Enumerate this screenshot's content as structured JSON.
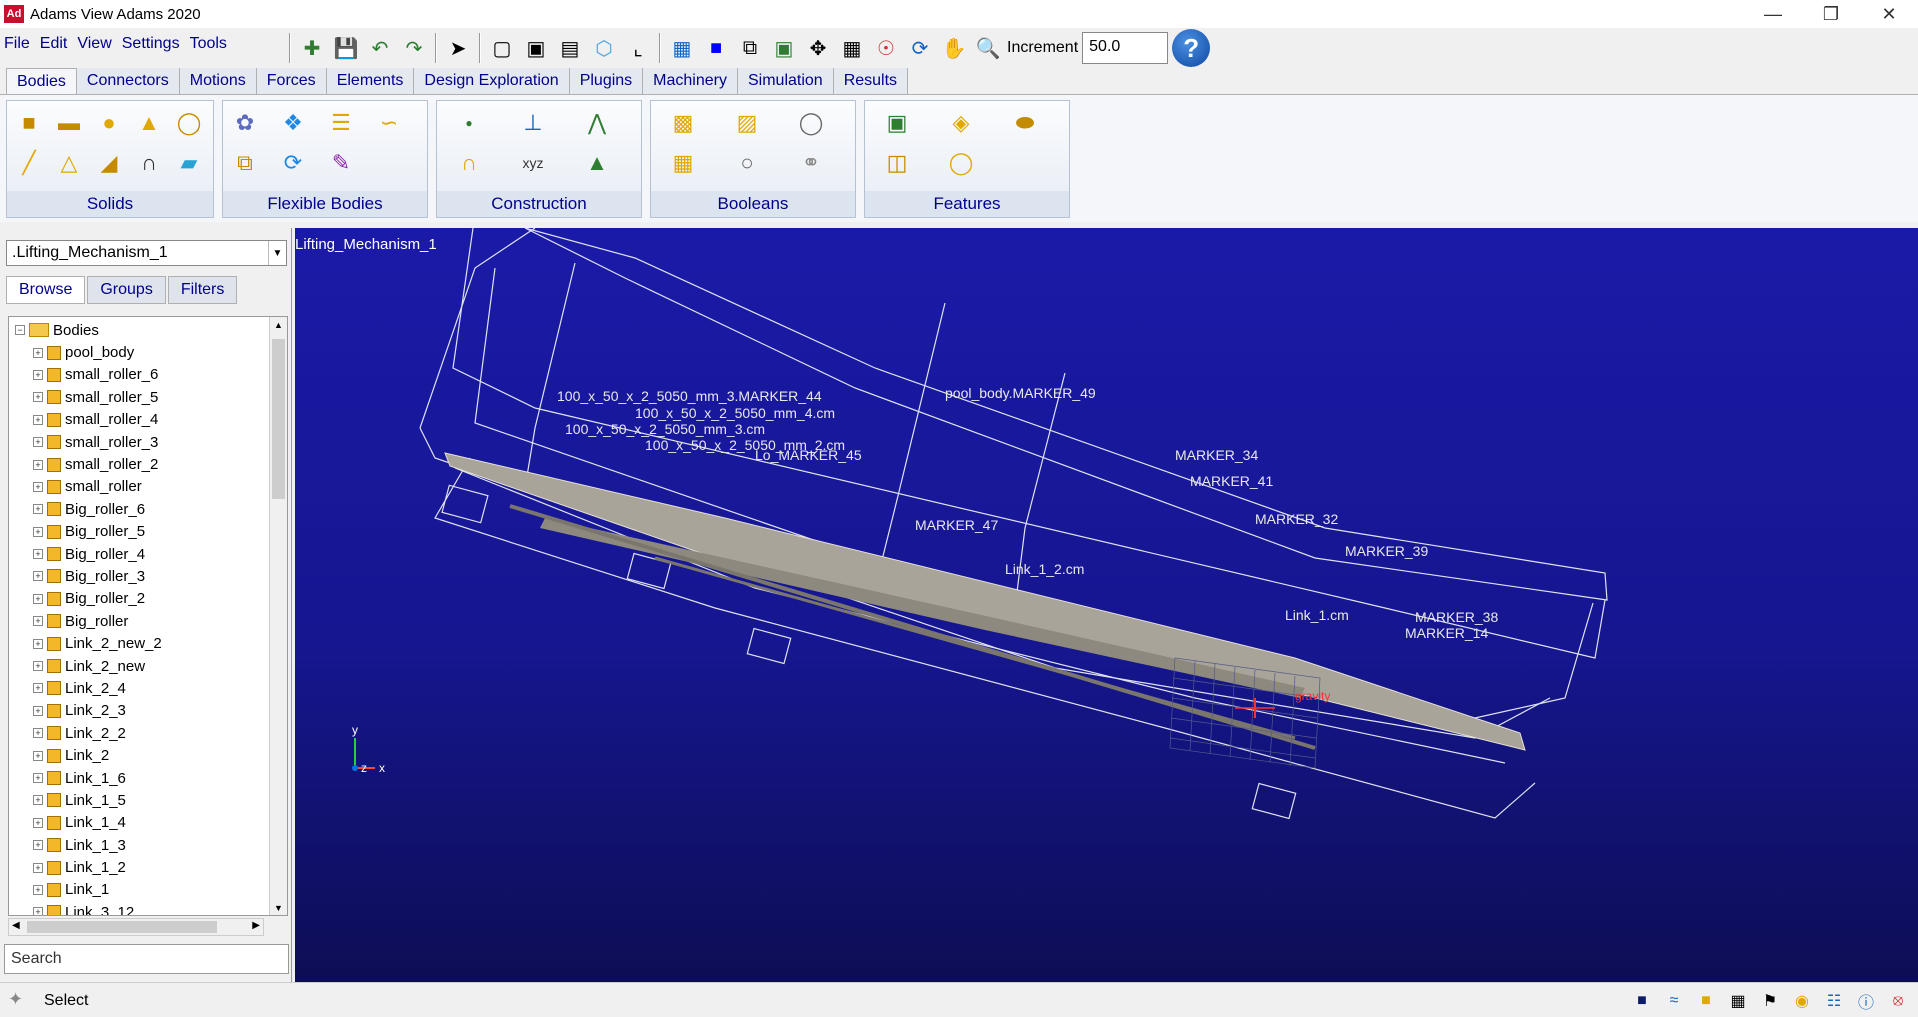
{
  "window": {
    "title": "Adams View Adams 2020",
    "app_icon": "Ad"
  },
  "menu": {
    "items": [
      "File",
      "Edit",
      "View",
      "Settings",
      "Tools"
    ]
  },
  "toolbar": {
    "increment_label": "Increment",
    "increment_value": "50.0",
    "help_glyph": "?"
  },
  "ribbon": {
    "tabs": [
      "Bodies",
      "Connectors",
      "Motions",
      "Forces",
      "Elements",
      "Design Exploration",
      "Plugins",
      "Machinery",
      "Simulation",
      "Results"
    ],
    "groups": {
      "solids": "Solids",
      "flex": "Flexible Bodies",
      "construction": "Construction",
      "booleans": "Booleans",
      "features": "Features"
    }
  },
  "browser": {
    "model": ".Lifting_Mechanism_1",
    "tabs": [
      "Browse",
      "Groups",
      "Filters"
    ],
    "root": "Bodies",
    "items": [
      "pool_body",
      "small_roller_6",
      "small_roller_5",
      "small_roller_4",
      "small_roller_3",
      "small_roller_2",
      "small_roller",
      "Big_roller_6",
      "Big_roller_5",
      "Big_roller_4",
      "Big_roller_3",
      "Big_roller_2",
      "Big_roller",
      "Link_2_new_2",
      "Link_2_new",
      "Link_2_4",
      "Link_2_3",
      "Link_2_2",
      "Link_2",
      "Link_1_6",
      "Link_1_5",
      "Link_1_4",
      "Link_1_3",
      "Link_1_2",
      "Link_1",
      "Link_3_12"
    ],
    "search_placeholder": "Search"
  },
  "viewport": {
    "model_label": "Lifting_Mechanism_1",
    "annotations": [
      "pool_body.MARKER_49",
      "100_x_50_x_2_5050_mm_3.MARKER_44",
      "100_x_50_x_2_5050_mm_4.cm",
      "100_x_50_x_2_5050_mm_3.cm",
      "100_x_50_x_2_5050_mm_2.cm",
      "Lo_MARKER_45",
      "MARKER_34",
      "MARKER_41",
      "MARKER_32",
      "MARKER_47",
      "MARKER_39",
      "MARKER_38",
      "MARKER_14",
      "Link_1_2.cm",
      "Link_1.cm",
      "gravity"
    ],
    "triad": {
      "y": "y",
      "z": "z",
      "x": "x"
    }
  },
  "status": {
    "text": "Select"
  },
  "colors": {
    "viewport_top": "#1a1aa8",
    "viewport_bottom": "#0d0d55",
    "menu_text": "#00008b",
    "accent": "#0d47a1"
  }
}
